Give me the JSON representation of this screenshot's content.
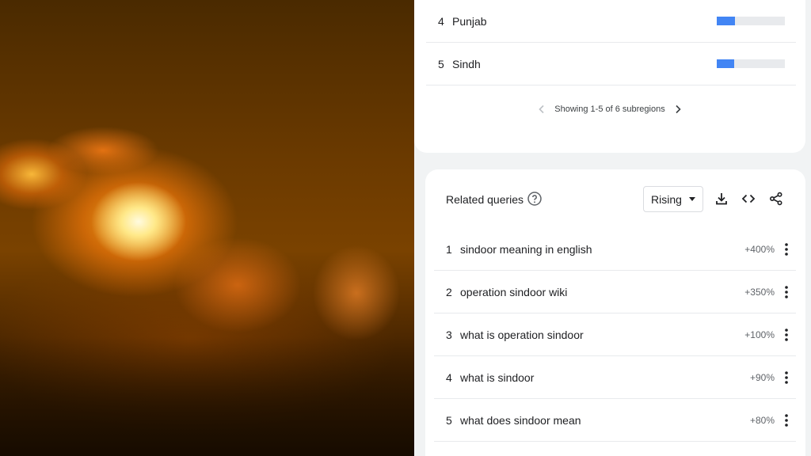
{
  "subregions": {
    "rows": [
      {
        "rank": "4",
        "name": "Punjab",
        "value": "27",
        "fraction": 0.27
      },
      {
        "rank": "5",
        "name": "Sindh",
        "value": "26",
        "fraction": 0.26
      }
    ],
    "pager_label": "Showing 1-5 of 6 subregions"
  },
  "related_queries": {
    "title": "Related queries",
    "filter_selected": "Rising",
    "rows": [
      {
        "rank": "1",
        "query": "sindoor meaning in english",
        "value": "+400%"
      },
      {
        "rank": "2",
        "query": "operation sindoor wiki",
        "value": "+350%"
      },
      {
        "rank": "3",
        "query": "what is operation sindoor",
        "value": "+100%"
      },
      {
        "rank": "4",
        "query": "what is sindoor",
        "value": "+90%"
      },
      {
        "rank": "5",
        "query": "what does sindoor mean",
        "value": "+80%"
      }
    ]
  },
  "colors": {
    "bar": "#4285f4",
    "track": "#e8eaed",
    "panel_bg": "#f1f3f4"
  },
  "icons": [
    "help-icon",
    "download-icon",
    "embed-code-icon",
    "share-icon",
    "more-vert-icon",
    "chevron-left-icon",
    "chevron-right-icon"
  ]
}
